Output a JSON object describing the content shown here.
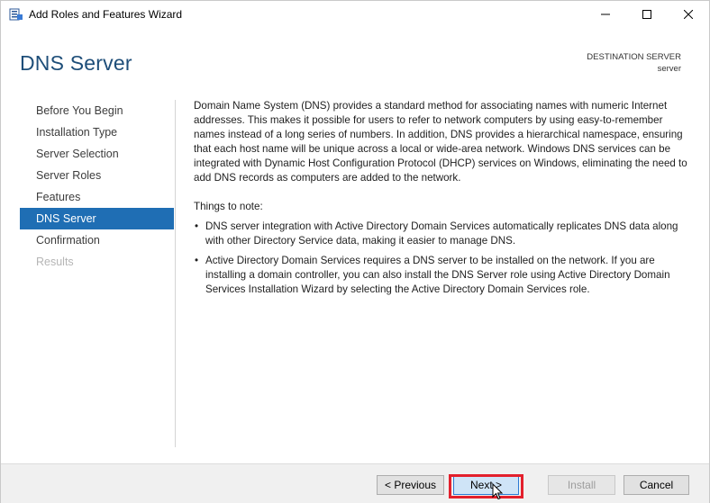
{
  "window": {
    "title": "Add Roles and Features Wizard",
    "icon": "server-manager-icon",
    "controls": {
      "minimize": "minimize-icon",
      "maximize": "maximize-icon",
      "close": "close-icon"
    }
  },
  "header": {
    "page_title": "DNS Server",
    "destination_label": "DESTINATION SERVER",
    "destination_value": "server"
  },
  "nav": {
    "items": [
      {
        "label": "Before You Begin",
        "state": "normal"
      },
      {
        "label": "Installation Type",
        "state": "normal"
      },
      {
        "label": "Server Selection",
        "state": "normal"
      },
      {
        "label": "Server Roles",
        "state": "normal"
      },
      {
        "label": "Features",
        "state": "normal"
      },
      {
        "label": "DNS Server",
        "state": "active"
      },
      {
        "label": "Confirmation",
        "state": "normal"
      },
      {
        "label": "Results",
        "state": "disabled"
      }
    ]
  },
  "content": {
    "intro": "Domain Name System (DNS) provides a standard method for associating names with numeric Internet addresses. This makes it possible for users to refer to network computers by using easy-to-remember names instead of a long series of numbers. In addition, DNS provides a hierarchical namespace, ensuring that each host name will be unique across a local or wide-area network. Windows DNS services can be integrated with Dynamic Host Configuration Protocol (DHCP) services on Windows, eliminating the need to add DNS records as computers are added to the network.",
    "notes_title": "Things to note:",
    "notes": [
      "DNS server integration with Active Directory Domain Services automatically replicates DNS data along with other Directory Service data, making it easier to manage DNS.",
      "Active Directory Domain Services requires a DNS server to be installed on the network. If you are installing a domain controller, you can also install the DNS Server role using Active Directory Domain Services Installation Wizard by selecting the Active Directory Domain Services role."
    ]
  },
  "footer": {
    "previous_label": "< Previous",
    "next_label": "Next >",
    "install_label": "Install",
    "cancel_label": "Cancel"
  },
  "colors": {
    "accent": "#1f6eb4",
    "heading": "#1e4e79",
    "highlight": "#e3202c"
  }
}
